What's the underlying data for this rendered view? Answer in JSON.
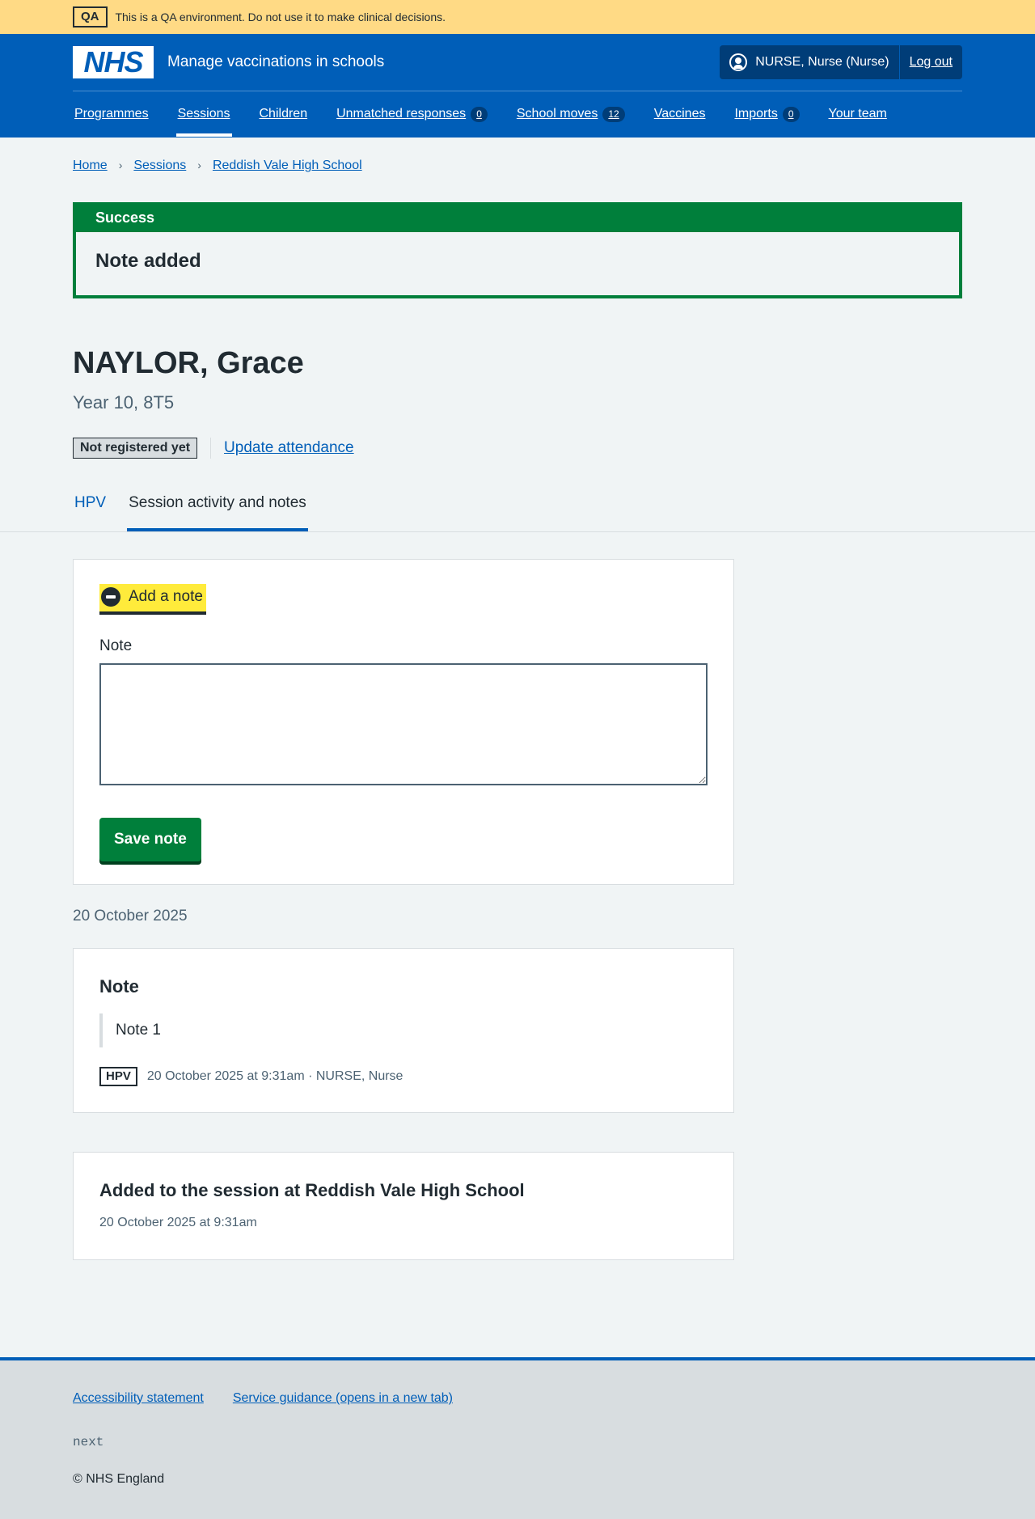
{
  "qa_banner": {
    "tag": "QA",
    "text": "This is a QA environment. Do not use it to make clinical decisions."
  },
  "header": {
    "logo": "NHS",
    "service_name": "Manage vaccinations in schools",
    "user": "NURSE, Nurse (Nurse)",
    "logout": "Log out",
    "nav": [
      {
        "label": "Programmes"
      },
      {
        "label": "Sessions"
      },
      {
        "label": "Children"
      },
      {
        "label": "Unmatched responses",
        "count": "0"
      },
      {
        "label": "School moves",
        "count": "12"
      },
      {
        "label": "Vaccines"
      },
      {
        "label": "Imports",
        "count": "0"
      },
      {
        "label": "Your team"
      }
    ]
  },
  "breadcrumb": [
    "Home",
    "Sessions",
    "Reddish Vale High School"
  ],
  "success": {
    "heading": "Success",
    "message": "Note added"
  },
  "person": {
    "name": "NAYLOR, Grace",
    "caption": "Year 10, 8T5",
    "status_tag": "Not registered yet",
    "attendance_link": "Update attendance"
  },
  "tabs": [
    "HPV",
    "Session activity and notes"
  ],
  "note_form": {
    "toggle": "Add a note",
    "label": "Note",
    "value": "",
    "save": "Save note"
  },
  "activity": {
    "date": "20 October 2025",
    "note_card": {
      "title": "Note",
      "body": "Note 1",
      "tag": "HPV",
      "meta": "20 October 2025 at 9:31am · NURSE, Nurse"
    },
    "event_card": {
      "title": "Added to the session at Reddish Vale High School",
      "time": "20 October 2025 at 9:31am"
    }
  },
  "footer": {
    "links": [
      "Accessibility statement",
      "Service guidance (opens in a new tab)"
    ],
    "version": "next",
    "copyright": "© NHS England"
  },
  "colors": {
    "nhs_blue": "#005eb8",
    "success_green": "#007f3b",
    "qa_yellow": "#ffda85",
    "focus_yellow": "#ffeb3b"
  }
}
